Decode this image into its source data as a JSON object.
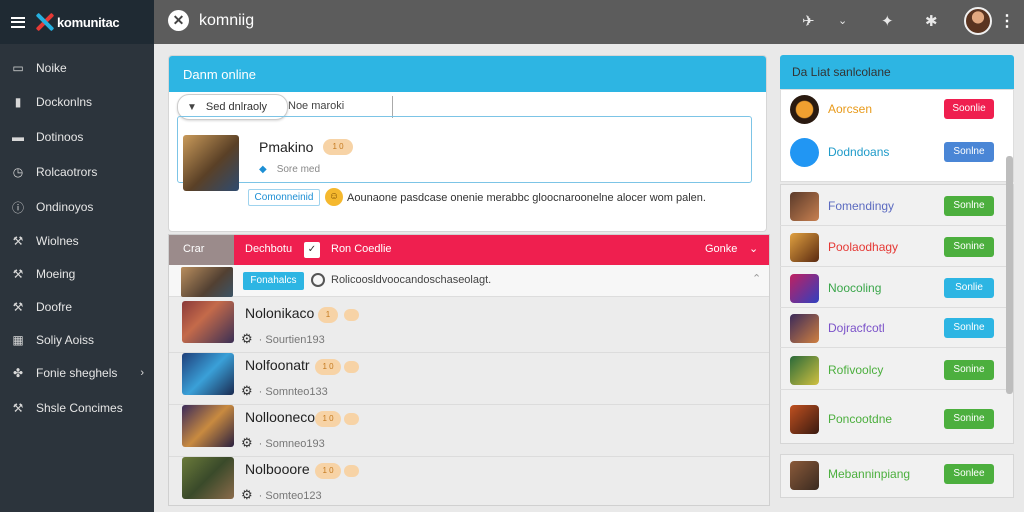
{
  "topbar": {
    "brand": "komunitac",
    "app_title": "komniig",
    "icons": [
      "pin-icon",
      "chevron-down-icon",
      "puzzle-icon",
      "gear-icon",
      "avatar",
      "kebab-icon"
    ]
  },
  "sidebar": {
    "items": [
      {
        "label": "Noike",
        "icon": "square-icon"
      },
      {
        "label": "Dockonlns",
        "icon": "bag-icon"
      },
      {
        "label": "Dotinoos",
        "icon": "briefcase-icon"
      },
      {
        "label": "Rolcaotrors",
        "icon": "clock-icon"
      },
      {
        "label": "Ondinoyos",
        "icon": "info-icon"
      },
      {
        "label": "Wiolnes",
        "icon": "wrench-icon"
      },
      {
        "label": "Moeing",
        "icon": "wrench-icon"
      },
      {
        "label": "Doofre",
        "icon": "wrench-icon"
      },
      {
        "label": "Soliy Aoiss",
        "icon": "grid-icon"
      },
      {
        "label": "Fonie sheghels",
        "icon": "puzzle-icon"
      },
      {
        "label": "Shsle Concimes",
        "icon": "wrench-icon"
      }
    ]
  },
  "main": {
    "top_card": {
      "title": "Danm online",
      "filter_label": "Sed dnlraoly",
      "filter_input": "Noe maroki",
      "post": {
        "name": "Pmakino",
        "badge": "1 0",
        "meta": "Sore med",
        "tag": "Comonneinid",
        "body": "Aounaone pasdcase onenie merabbc gloocnaroonelne alocer wom palen."
      }
    },
    "list": {
      "left_header": "Crar",
      "title": "Dechbotu",
      "subtitle": "Ron Coedlie",
      "right_label": "Gonke",
      "sub_tag": "Fonahalcs",
      "sub_text": "Rolicoosldvoocandoschaseolagt.",
      "rows": [
        {
          "name": "Nolonikaco",
          "badge": "1",
          "meta": "Sourtien193"
        },
        {
          "name": "Nolfoonatr",
          "badge": "1 0",
          "meta": "Somnteo133"
        },
        {
          "name": "Nollooneco",
          "badge": "1 0",
          "meta": "Somneo193"
        },
        {
          "name": "Nolbooore",
          "badge": "1 0",
          "meta": "Somteo123"
        }
      ]
    }
  },
  "right_panel": {
    "title": "Da Liat sanlcolane",
    "top_rows": [
      {
        "name": "Aorcsen",
        "button": "Soonlie",
        "color": "#ef1f4f",
        "name_color": "#e89a1a"
      },
      {
        "name": "Dodndoans",
        "button": "Sonlne",
        "color": "#4a86d6",
        "name_color": "#1f9bc9"
      }
    ],
    "rows": [
      {
        "name": "Fomendingy",
        "button": "Sonlne",
        "color": "#4caf3e",
        "name_color": "#5c6bc0"
      },
      {
        "name": "Poolaodhagy",
        "button": "Sonine",
        "color": "#4caf3e",
        "name_color": "#e53935"
      },
      {
        "name": "Noocoling",
        "button": "Sonlie",
        "color": "#2db5e3",
        "name_color": "#3aa64a"
      },
      {
        "name": "Dojracfcotl",
        "button": "Sonlne",
        "color": "#2db5e3",
        "name_color": "#7b52c9"
      },
      {
        "name": "Rofivoolcy",
        "button": "Sonine",
        "color": "#4caf3e",
        "name_color": "#4caf3e"
      },
      {
        "name": "Poncootdne",
        "button": "Sonine",
        "color": "#4caf3e",
        "name_color": "#4caf3e"
      }
    ],
    "bottom_row": {
      "name": "Mebanninpiang",
      "button": "Sonlee",
      "color": "#4caf3e",
      "name_color": "#4caf3e"
    }
  }
}
